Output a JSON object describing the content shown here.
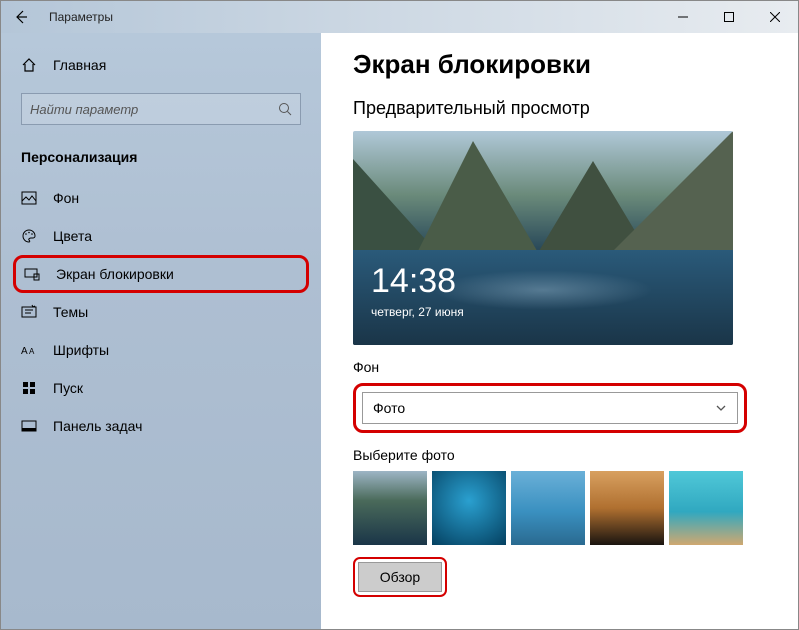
{
  "window": {
    "title": "Параметры"
  },
  "sidebar": {
    "home": "Главная",
    "search_placeholder": "Найти параметр",
    "category": "Персонализация",
    "items": [
      {
        "label": "Фон"
      },
      {
        "label": "Цвета"
      },
      {
        "label": "Экран блокировки"
      },
      {
        "label": "Темы"
      },
      {
        "label": "Шрифты"
      },
      {
        "label": "Пуск"
      },
      {
        "label": "Панель задач"
      }
    ]
  },
  "main": {
    "heading": "Экран блокировки",
    "preview_label": "Предварительный просмотр",
    "preview_time": "14:38",
    "preview_date": "четверг, 27 июня",
    "background_label": "Фон",
    "background_value": "Фото",
    "choose_label": "Выберите фото",
    "browse_label": "Обзор"
  }
}
